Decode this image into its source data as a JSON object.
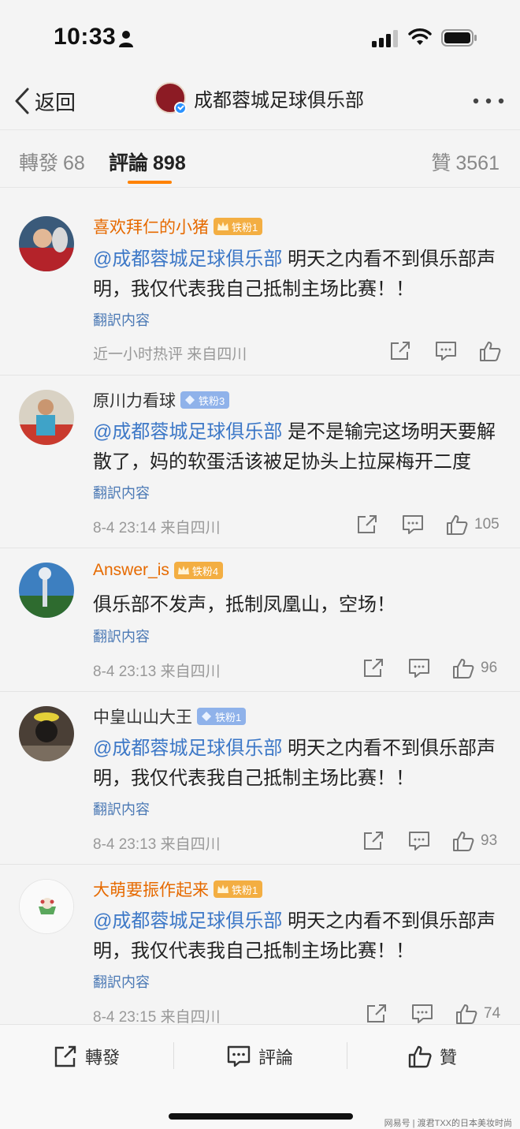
{
  "status_bar": {
    "time": "10:33"
  },
  "nav": {
    "back_label": "返回",
    "title": "成都蓉城足球俱乐部"
  },
  "tabs": {
    "repost_label": "轉發",
    "repost_count": "68",
    "comment_label": "評論",
    "comment_count": "898",
    "like_label": "贊",
    "like_count": "3561"
  },
  "comments": [
    {
      "username": "喜欢拜仁的小猪",
      "fan_badge": "铁粉1",
      "mention": "@成都蓉城足球俱乐部",
      "text": " 明天之内看不到俱乐部声明，我仅代表我自己抵制主场比赛！！",
      "translate": "翻訳内容",
      "meta": "近一小时热评  来自四川",
      "likes": ""
    },
    {
      "username": "原川力看球",
      "fan_badge": "铁粉3",
      "mention": "@成都蓉城足球俱乐部",
      "text": "  是不是输完这场明天要解散了，妈的软蛋活该被足协头上拉屎梅开二度",
      "translate": "翻訳内容",
      "meta": "8-4 23:14  来自四川",
      "likes": "105"
    },
    {
      "username": "Answer_is",
      "fan_badge": "铁粉4",
      "mention": "",
      "text": "俱乐部不发声，抵制凤凰山，空场！",
      "translate": "翻訳内容",
      "meta": "8-4 23:13  来自四川",
      "likes": "96"
    },
    {
      "username": "中皇山山大王",
      "fan_badge": "铁粉1",
      "mention": "@成都蓉城足球俱乐部",
      "text": " 明天之内看不到俱乐部声明，我仅代表我自己抵制主场比赛！！",
      "translate": "翻訳内容",
      "meta": "8-4 23:13  来自四川",
      "likes": "93"
    },
    {
      "username": "大萌要振作起来",
      "fan_badge": "铁粉1",
      "mention": "@成都蓉城足球俱乐部",
      "text": " 明天之内看不到俱乐部声明，我仅代表我自己抵制主场比赛！！",
      "translate": "翻訳内容",
      "meta": "8-4 23:15  来自四川",
      "likes": "74"
    }
  ],
  "bottom_bar": {
    "repost_label": "轉發",
    "comment_label": "評論",
    "like_label": "贊"
  },
  "watermark": "网易号 | 渡君TXX的日本美妆时尚",
  "colors": {
    "accent": "#ff8200",
    "mention": "#3d78c7",
    "gold_badge": "#f3ae42",
    "blue_badge": "#8fb2ea"
  }
}
